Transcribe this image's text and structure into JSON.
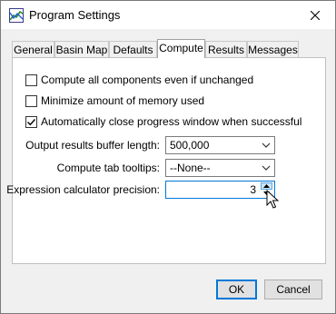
{
  "window": {
    "title": "Program Settings"
  },
  "tabs": [
    {
      "label": "General"
    },
    {
      "label": "Basin Map"
    },
    {
      "label": "Defaults"
    },
    {
      "label": "Compute",
      "active": true
    },
    {
      "label": "Results"
    },
    {
      "label": "Messages"
    }
  ],
  "compute": {
    "checkboxes": [
      {
        "label": "Compute all components even if unchanged",
        "checked": false
      },
      {
        "label": "Minimize amount of memory used",
        "checked": false
      },
      {
        "label": "Automatically close progress window when successful",
        "checked": true
      }
    ],
    "buffer": {
      "label": "Output results buffer length:",
      "value": "500,000"
    },
    "tooltips": {
      "label": "Compute tab tooltips:",
      "value": "--None--"
    },
    "precision": {
      "label": "Expression calculator precision:",
      "value": "3"
    }
  },
  "buttons": {
    "ok": "OK",
    "cancel": "Cancel"
  },
  "icons": {
    "app": "chart-app-icon",
    "close": "close-icon",
    "check": "checkmark-icon",
    "chevron": "chevron-down-icon",
    "spin_up": "spin-up-arrow-icon",
    "spin_down": "spin-down-arrow-icon",
    "cursor": "mouse-pointer-icon"
  },
  "colors": {
    "accent": "#0078d7",
    "spinner_hover": "#cce4f7"
  }
}
